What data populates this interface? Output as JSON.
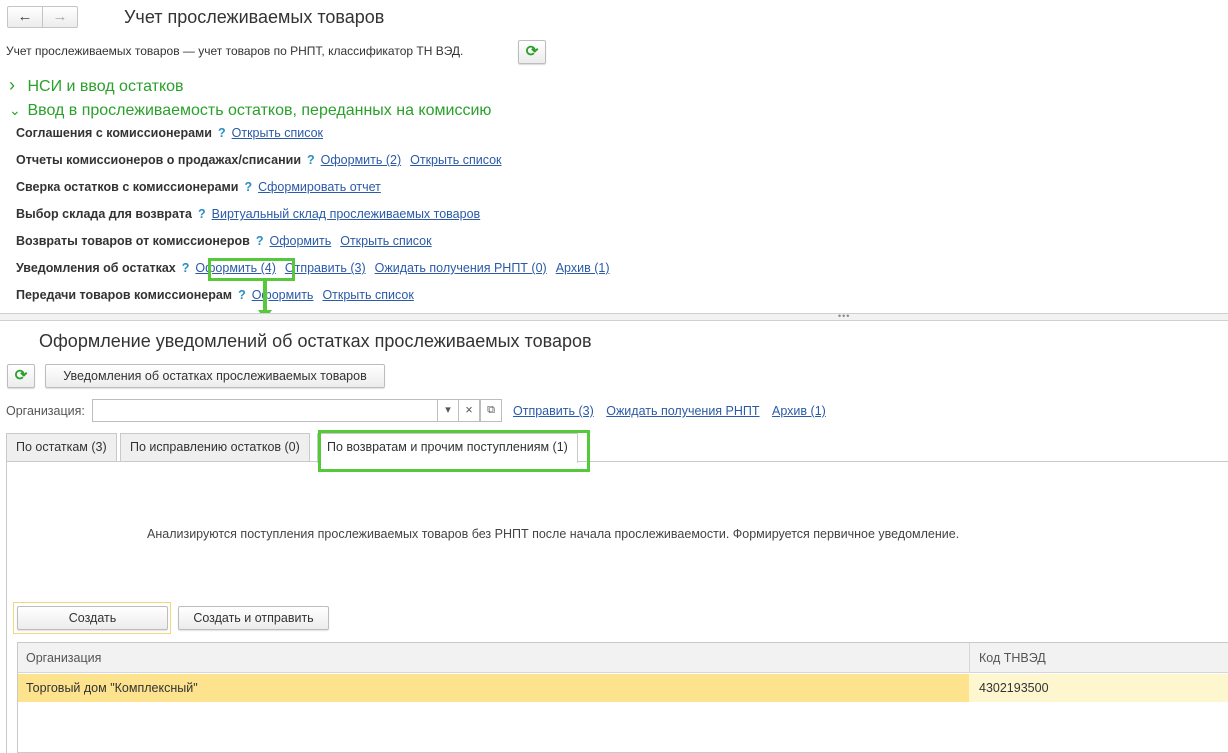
{
  "top": {
    "title": "Учет прослеживаемых товаров",
    "subtitle": "Учет прослеживаемых товаров — учет товаров по РНПТ, классификатор ТН ВЭД.",
    "back_icon": "←",
    "forward_icon": "→",
    "refresh_icon": "⟳"
  },
  "groups": {
    "nsi": "НСИ и ввод остатков",
    "commission": "Ввод в прослеживаемость остатков, переданных на комиссию",
    "collapsed_icon": "›",
    "expanded_icon": "⌄"
  },
  "rows": [
    {
      "label": "Соглашения с комиссионерами",
      "links": [
        "Открыть список"
      ]
    },
    {
      "label": "Отчеты комиссионеров о продажах/списании",
      "links": [
        "Оформить (2)",
        "Открыть список"
      ]
    },
    {
      "label": "Сверка остатков с комиссионерами",
      "links": [
        "Сформировать отчет"
      ]
    },
    {
      "label": "Выбор склада для возврата",
      "links": [
        "Виртуальный склад прослеживаемых товаров"
      ]
    },
    {
      "label": "Возвраты товаров от комиссионеров",
      "links": [
        "Оформить",
        "Открыть список"
      ]
    },
    {
      "label": "Уведомления об остатках",
      "links": [
        "Оформить (4)",
        "Отправить (3)",
        "Ожидать получения РНПТ (0)",
        "Архив (1)"
      ]
    },
    {
      "label": "Передачи товаров комиссионерам",
      "links": [
        "Оформить",
        "Открыть список"
      ]
    }
  ],
  "help_mark": "?",
  "splitter": "•••",
  "form": {
    "title": "Оформление уведомлений об остатках прослеживаемых товаров",
    "report_button": "Уведомления об остатках прослеживаемых товаров",
    "org_label": "Организация:",
    "org_value": "",
    "dropdown_icon": "▾",
    "clear_icon": "×",
    "open_icon": "⧉",
    "links": [
      "Отправить (3)",
      "Ожидать получения РНПТ",
      "Архив (1)"
    ],
    "tabs": [
      "По остаткам (3)",
      "По исправлению остатков (0)",
      "По возвратам и прочим поступлениям (1)"
    ],
    "info": "Анализируются поступления прослеживаемых товаров без РНПТ после начала прослеживаемости. Формируется первичное уведомление.",
    "create_button": "Создать",
    "create_send_button": "Создать и отправить",
    "table": {
      "headers": [
        "Организация",
        "Код ТНВЭД"
      ],
      "rows": [
        [
          "Торговый дом \"Комплексный\"",
          "4302193500"
        ]
      ]
    }
  },
  "colors": {
    "accent_green": "#2aa12a",
    "highlight": "#55c93a",
    "link": "#2b5aa8",
    "selected_row": "#fde38e"
  }
}
